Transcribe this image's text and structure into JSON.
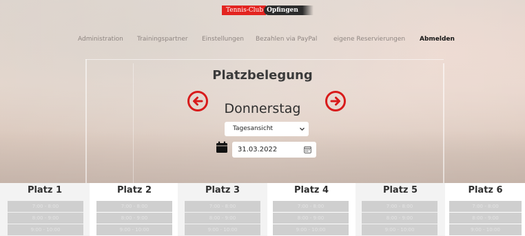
{
  "brand": {
    "club": "Tennis-Club",
    "town": "Opfingen"
  },
  "nav": [
    {
      "label": "Administration"
    },
    {
      "label": "Trainingspartner"
    },
    {
      "label": "Einstellungen"
    },
    {
      "label": "Bezahlen via PayPal"
    },
    {
      "label": "eigene Reservierungen"
    },
    {
      "label": "Abmelden"
    }
  ],
  "page": {
    "title": "Platzbelegung",
    "day": "Donnerstag",
    "view_select": {
      "selected": "Tagesansicht"
    },
    "date_value": "31.03.2022"
  },
  "icons": {
    "prev": "arrow-left-circle-icon",
    "next": "arrow-right-circle-icon",
    "calendar": "calendar-icon",
    "date_picker": "calendar-picker-icon",
    "select_chevron": "chevron-down-icon"
  },
  "colors": {
    "accent": "#d81b1b",
    "brand_red": "#e32420",
    "brand_dark": "#2b2b2b",
    "slot": "#cfcfcf"
  },
  "courts": [
    {
      "name": "Platz 1",
      "slots": [
        "7:00 - 8:00",
        "8:00 - 9:00",
        "9:00 - 10:00"
      ]
    },
    {
      "name": "Platz 2",
      "slots": [
        "7:00 - 8:00",
        "8:00 - 9:00",
        "9:00 - 10:00"
      ]
    },
    {
      "name": "Platz 3",
      "slots": [
        "7:00 - 8:00",
        "8:00 - 9:00",
        "9:00 - 10:00"
      ]
    },
    {
      "name": "Platz 4",
      "slots": [
        "7:00 - 8:00",
        "8:00 - 9:00",
        "9:00 - 10:00"
      ]
    },
    {
      "name": "Platz 5",
      "slots": [
        "7:00 - 8:00",
        "8:00 - 9:00",
        "9:00 - 10:00"
      ]
    },
    {
      "name": "Platz 6",
      "slots": [
        "7:00 - 8:00",
        "8:00 - 9:00",
        "9:00 - 10:00"
      ]
    }
  ]
}
